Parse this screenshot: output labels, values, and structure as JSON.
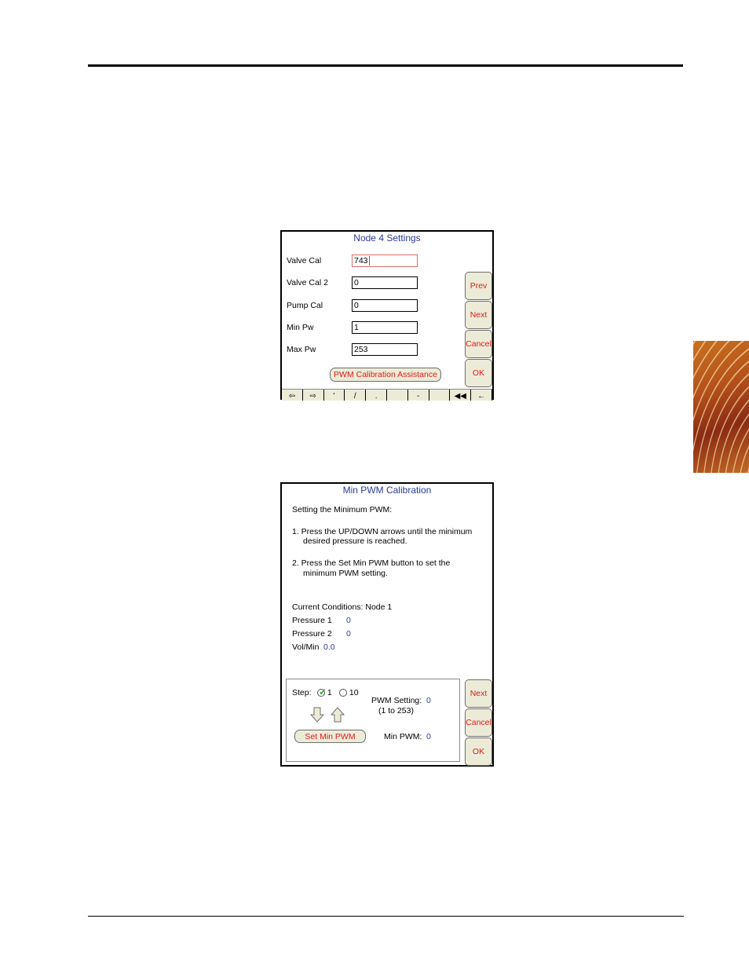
{
  "screen1": {
    "title": "Node 4 Settings",
    "fields": [
      {
        "label": "Valve Cal",
        "value": "743"
      },
      {
        "label": "Valve Cal 2",
        "value": "0"
      },
      {
        "label": "Pump Cal",
        "value": "0"
      },
      {
        "label": "Min Pw",
        "value": "1"
      },
      {
        "label": "Max Pw",
        "value": "253"
      }
    ],
    "assist_button": "PWM Calibration Assistance",
    "side_buttons": [
      "Prev",
      "Next",
      "Cancel",
      "OK"
    ],
    "keyboard_keys": [
      "⇦",
      "⇨",
      "'",
      "/",
      ".",
      "",
      "-",
      "",
      "◀◀",
      "←"
    ]
  },
  "screen2": {
    "title": "Min PWM Calibration",
    "heading": "Setting the Minimum PWM:",
    "step1_line1": "1.  Press the UP/DOWN arrows until the minimum",
    "step1_line2": "desired pressure is reached.",
    "step2_line1": "2.  Press the Set Min PWM button to set the",
    "step2_line2": "minimum PWM setting.",
    "conditions_label": "Current Conditions: Node 1",
    "pressure1_label": "Pressure 1",
    "pressure1_value": "0",
    "pressure2_label": "Pressure 2",
    "pressure2_value": "0",
    "volmin_label": "Vol/Min",
    "volmin_value": "0.0",
    "step_label": "Step:",
    "step_option1": "1",
    "step_option2": "10",
    "pwm_setting_label": "PWM Setting:",
    "pwm_setting_value": "0",
    "pwm_range": "(1 to 253)",
    "set_min_button": "Set Min PWM",
    "min_pwm_label": "Min PWM:",
    "min_pwm_value": "0",
    "side_buttons": [
      "Next",
      "Cancel",
      "OK"
    ]
  },
  "colors": {
    "title_blue": "#2b3a9a",
    "button_red": "#e01a1a",
    "button_bg": "#ecebd8"
  }
}
